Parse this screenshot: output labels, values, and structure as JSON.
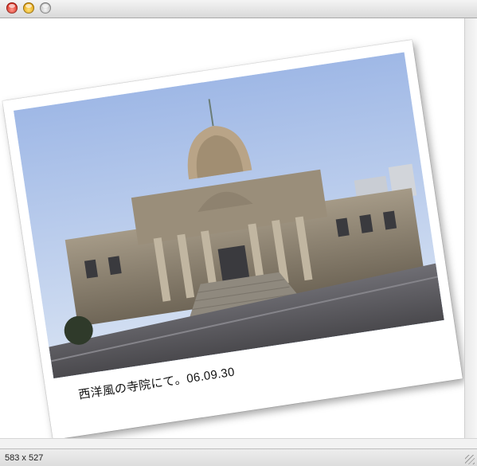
{
  "window": {
    "controls": {
      "close": "close-icon",
      "minimize": "minimize-icon",
      "zoom": "zoom-icon"
    }
  },
  "photo": {
    "caption": "西洋風の寺院にて。06.09.30",
    "subject": "temple-photo"
  },
  "statusbar": {
    "dimensions": "583 x 527"
  }
}
